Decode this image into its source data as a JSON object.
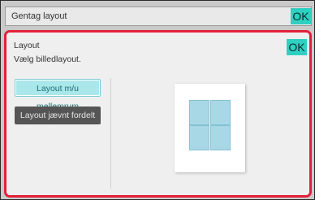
{
  "top_bar": {
    "label": "Gentag layout",
    "ok_label": "OK"
  },
  "panel": {
    "title": "Layout",
    "subtitle": "Vælg billedlayout.",
    "ok_label": "OK",
    "options": [
      {
        "label": "Layout m/u mellemrum",
        "selected": true
      },
      {
        "label": "Layout jævnt fordelt",
        "selected": false
      }
    ]
  },
  "preview": {
    "grid_rows": 2,
    "grid_cols": 2,
    "cell_color": "#a8d8e6"
  },
  "colors": {
    "ok_accent": "#2fd0c2",
    "panel_border": "#e3203a",
    "selected_option": "#a9e7ea",
    "unselected_option": "#555555"
  }
}
